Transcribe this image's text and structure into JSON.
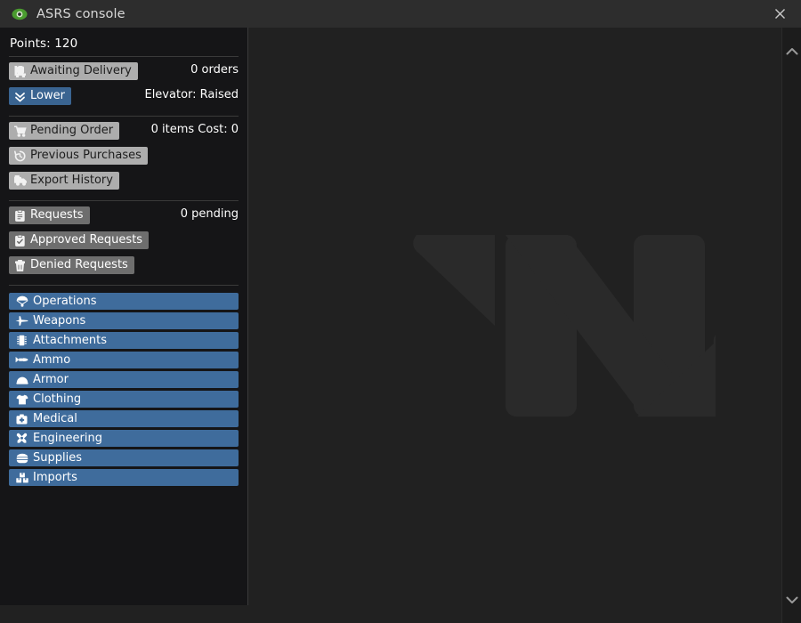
{
  "window": {
    "title": "ASRS console",
    "app_icon": "eye-icon",
    "accent_green": "#4a9b2f",
    "close_label": "×"
  },
  "sidebar": {
    "points_label": "Points: 120",
    "delivery": {
      "awaiting_button": {
        "label": "Awaiting Delivery",
        "icon": "luggage-cart-icon"
      },
      "orders_status": "0 orders",
      "lower_button": {
        "label": "Lower",
        "icon": "double-chevron-down-icon"
      },
      "elevator_status": "Elevator: Raised"
    },
    "orders": {
      "pending_button": {
        "label": "Pending Order",
        "icon": "shopping-cart-icon"
      },
      "pending_status": "0 items Cost: 0",
      "previous_button": {
        "label": "Previous Purchases",
        "icon": "history-icon"
      },
      "export_button": {
        "label": "Export History",
        "icon": "delivery-truck-icon"
      }
    },
    "requests": {
      "requests_button": {
        "label": "Requests",
        "icon": "clipboard-icon"
      },
      "pending_status": "0 pending",
      "approved_button": {
        "label": "Approved Requests",
        "icon": "clipboard-check-icon"
      },
      "denied_button": {
        "label": "Denied Requests",
        "icon": "trash-icon"
      }
    },
    "categories": [
      {
        "label": "Operations",
        "icon": "parachute-icon"
      },
      {
        "label": "Weapons",
        "icon": "jet-fighter-icon"
      },
      {
        "label": "Attachments",
        "icon": "microchip-icon"
      },
      {
        "label": "Ammo",
        "icon": "bullet-icon"
      },
      {
        "label": "Armor",
        "icon": "helmet-icon"
      },
      {
        "label": "Clothing",
        "icon": "tshirt-icon"
      },
      {
        "label": "Medical",
        "icon": "medical-kit-icon"
      },
      {
        "label": "Engineering",
        "icon": "crossed-tools-icon"
      },
      {
        "label": "Supplies",
        "icon": "supply-stack-icon"
      },
      {
        "label": "Imports",
        "icon": "boxes-icon"
      }
    ],
    "category_color": "#3f6c9c"
  },
  "panel": {
    "watermark_icon": "letter-n-logo",
    "background_color": "#212121"
  },
  "scrollbar": {
    "up_icon": "chevron-up-icon",
    "down_icon": "chevron-down-icon"
  }
}
